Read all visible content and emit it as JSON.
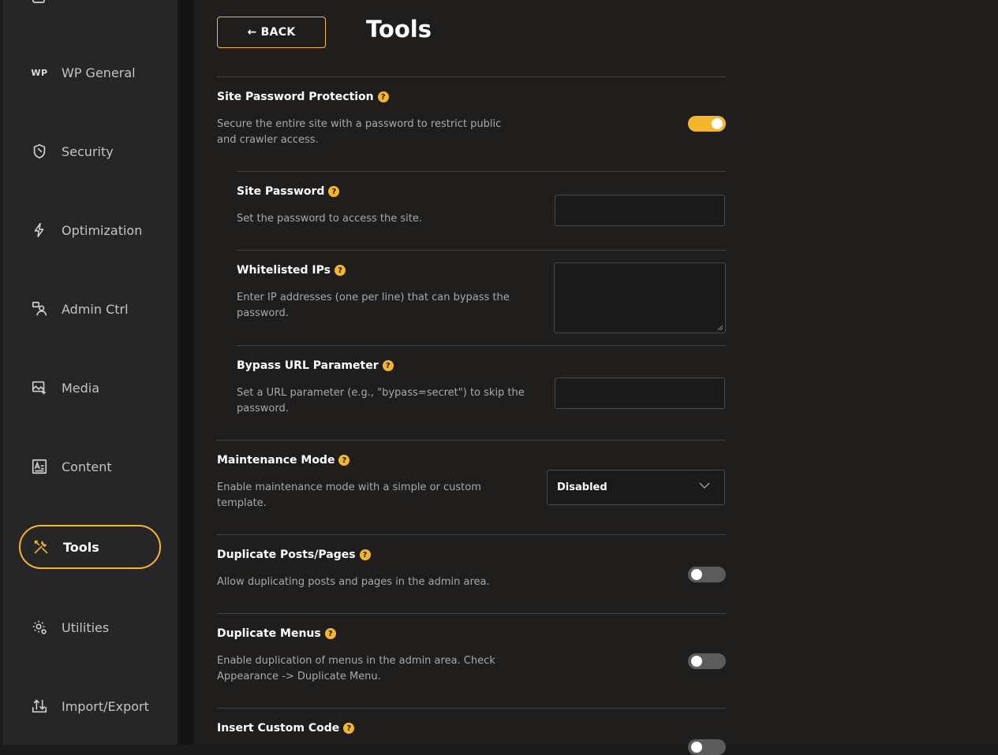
{
  "sidebar": {
    "items": [
      {
        "label": "WP General",
        "icon": "wp-icon"
      },
      {
        "label": "Security",
        "icon": "shield-icon"
      },
      {
        "label": "Optimization",
        "icon": "bolt-icon"
      },
      {
        "label": "Admin Ctrl",
        "icon": "admin-user-icon"
      },
      {
        "label": "Media",
        "icon": "media-icon"
      },
      {
        "label": "Content",
        "icon": "content-icon"
      },
      {
        "label": "Tools",
        "icon": "tools-icon",
        "active": true
      },
      {
        "label": "Utilities",
        "icon": "gear-icon"
      },
      {
        "label": "Import/Export",
        "icon": "import-export-icon"
      }
    ],
    "wp_text": "WP"
  },
  "header": {
    "back_label": "← BACK",
    "title": "Tools"
  },
  "settings": {
    "site_password_protection": {
      "title": "Site Password Protection",
      "desc": "Secure the entire site with a password to restrict public and crawler access.",
      "enabled": true
    },
    "site_password": {
      "title": "Site Password",
      "desc": "Set the password to access the site.",
      "value": ""
    },
    "whitelisted_ips": {
      "title": "Whitelisted IPs",
      "desc": "Enter IP addresses (one per line) that can bypass the password.",
      "value": ""
    },
    "bypass_url_parameter": {
      "title": "Bypass URL Parameter",
      "desc": "Set a URL parameter (e.g., \"bypass=secret\") to skip the password.",
      "value": ""
    },
    "maintenance_mode": {
      "title": "Maintenance Mode",
      "desc": "Enable maintenance mode with a simple or custom template.",
      "selected": "Disabled"
    },
    "duplicate_posts": {
      "title": "Duplicate Posts/Pages",
      "desc": "Allow duplicating posts and pages in the admin area.",
      "enabled": false
    },
    "duplicate_menus": {
      "title": "Duplicate Menus",
      "desc": "Enable duplication of menus in the admin area. Check Appearance -> Duplicate Menu.",
      "enabled": false
    },
    "insert_custom_code": {
      "title": "Insert Custom Code",
      "enabled": false
    }
  },
  "help_glyph": "?",
  "colors": {
    "accent": "#f5b62c",
    "sidebar_bg": "#262626",
    "main_bg": "#1f1e1d",
    "toggle_off": "#5c5c5c"
  }
}
